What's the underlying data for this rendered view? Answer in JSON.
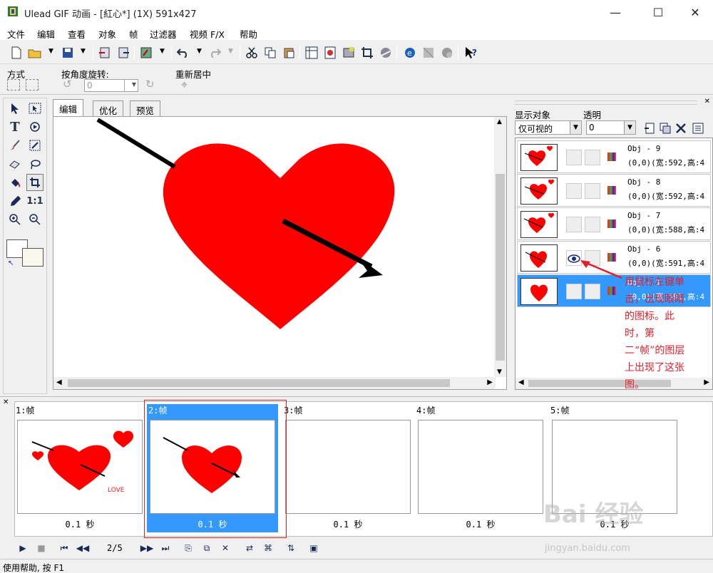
{
  "window": {
    "title": "Ulead GIF 动画 - [紅心*] (1X) 591x427",
    "minimize": "—",
    "maximize": "☐",
    "close": "✕"
  },
  "menu": [
    "文件",
    "编辑",
    "查看",
    "对象",
    "帧",
    "过滤器",
    "视频 F/X",
    "帮助"
  ],
  "propbar": {
    "mode_label": "方式",
    "rotate_label": "按角度旋转:",
    "rotate_value": "0",
    "recenter_label": "重新居中"
  },
  "tool_labels": {
    "text": "T",
    "ratio": "1:1"
  },
  "tabs": [
    "编辑",
    "优化",
    "预览"
  ],
  "object_panel": {
    "display_label": "显示对象",
    "display_value": "仅可视的",
    "opacity_label": "透明",
    "opacity_value": "0",
    "objects": [
      {
        "name": "Obj - 9",
        "info": "(0,0)(宽:592,高:4"
      },
      {
        "name": "Obj - 8",
        "info": "(0,0)(宽:592,高:4"
      },
      {
        "name": "Obj - 7",
        "info": "(0,0)(宽:588,高:4"
      },
      {
        "name": "Obj - 6",
        "info": "(0,0)(宽:591,高:4"
      },
      {
        "name": "Obj - 1",
        "info": "(0,0)(宽:591,高:4"
      }
    ]
  },
  "annotation": "用鼠标左键单击，出现眼睛的图标。此时，第二“帧”的图层上出现了这张图。",
  "frames": [
    {
      "label": "1:帧",
      "duration": "0.1 秒"
    },
    {
      "label": "2:帧",
      "duration": "0.1 秒"
    },
    {
      "label": "3:帧",
      "duration": "0.1 秒"
    },
    {
      "label": "4:帧",
      "duration": "0.1 秒"
    },
    {
      "label": "5:帧",
      "duration": "0.1 秒"
    }
  ],
  "love_text": "LOVE",
  "frame_counter": "2/5",
  "status": "使用帮助, 按 F1",
  "watermark": {
    "brand": "Bai 经验",
    "url": "jingyan.baidu.com"
  },
  "colors": {
    "accent": "#3399ff",
    "heart": "#ff0000",
    "annotation": "#e0202a"
  }
}
